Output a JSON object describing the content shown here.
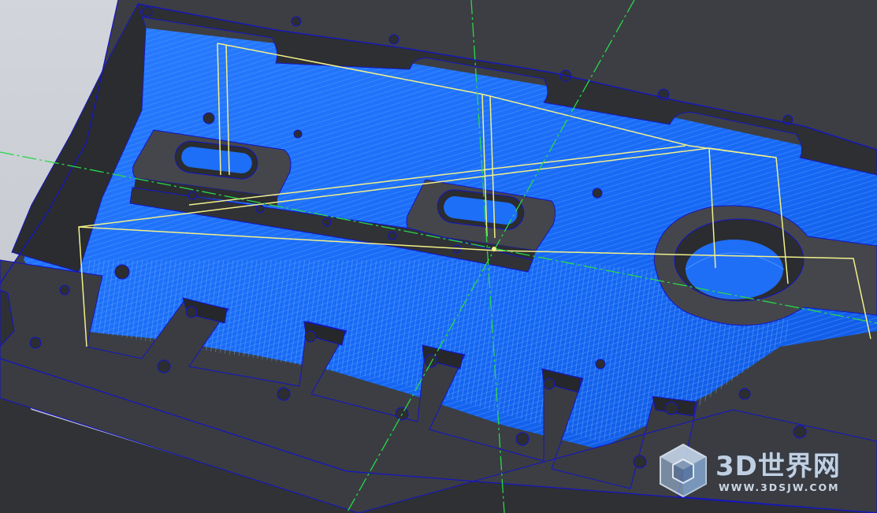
{
  "colors": {
    "background": "#c9ccd3",
    "part_dark": "#3b3d42",
    "part_wall": "#2a2c30",
    "toolpath_blue": "#1a73ff",
    "toolpath_light": "#3d8cff",
    "outline_blue": "#1414c8",
    "link_yellow": "#f2f08a",
    "axis_green": "#27d84a"
  },
  "viewport": {
    "name": "cam-3d-viewport"
  },
  "watermark": {
    "title": "3D世界网",
    "url": "WWW.3DSJW.COM",
    "logo_icon": "cube-logo-icon"
  }
}
